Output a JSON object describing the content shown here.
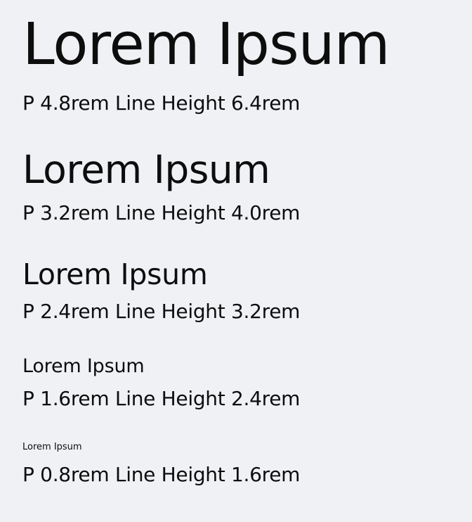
{
  "samples": [
    {
      "text": "Lorem Ipsum",
      "caption": "P 4.8rem Line Height 6.4rem"
    },
    {
      "text": "Lorem Ipsum",
      "caption": "P 3.2rem Line Height 4.0rem"
    },
    {
      "text": "Lorem Ipsum",
      "caption": "P 2.4rem Line Height 3.2rem"
    },
    {
      "text": "Lorem Ipsum",
      "caption": "P 1.6rem Line Height 2.4rem"
    },
    {
      "text": "Lorem Ipsum",
      "caption": "P 0.8rem Line Height 1.6rem"
    }
  ]
}
